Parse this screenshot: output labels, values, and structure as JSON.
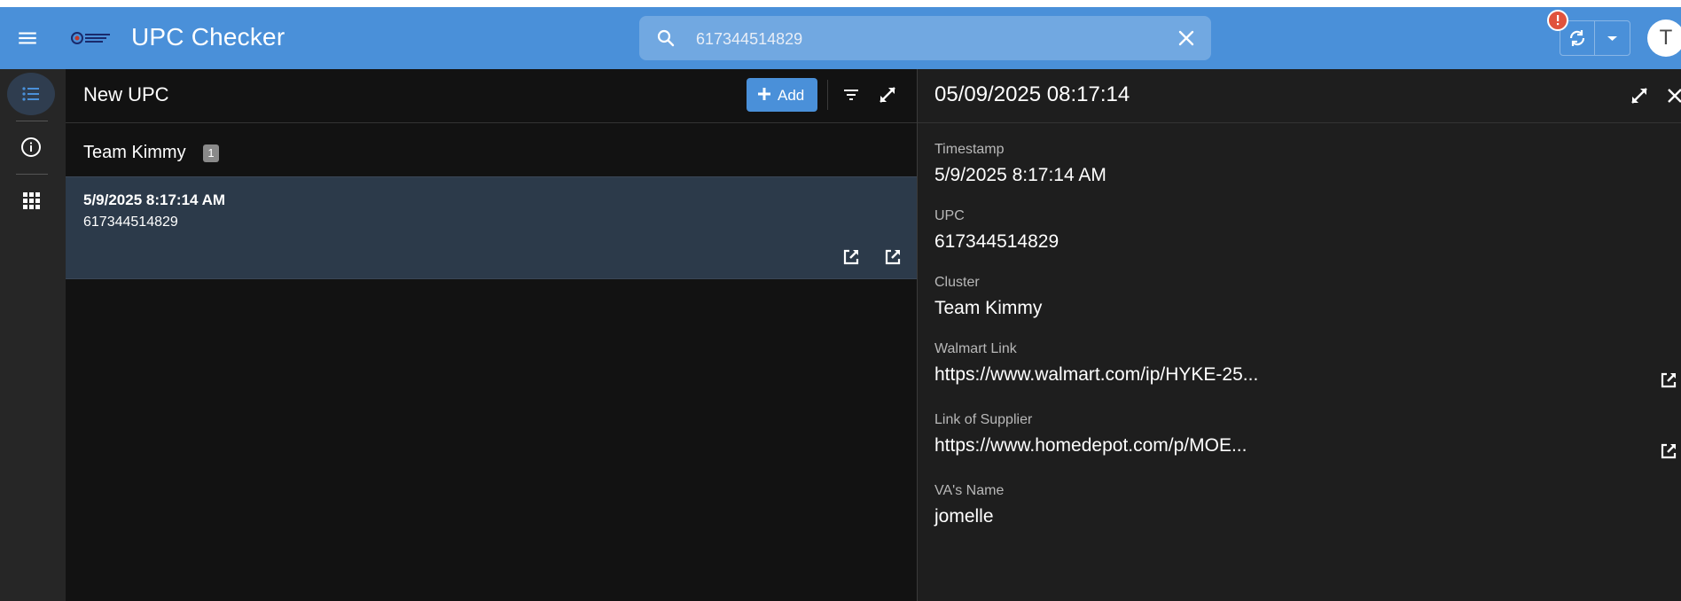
{
  "app": {
    "title": "UPC Checker",
    "avatar_initial": "T"
  },
  "search": {
    "value": "617344514829"
  },
  "list": {
    "title": "New UPC",
    "add_label": "Add",
    "group": {
      "name": "Team Kimmy",
      "count": "1"
    },
    "rows": [
      {
        "title": "5/9/2025 8:17:14 AM",
        "subtitle": "617344514829"
      }
    ]
  },
  "detail": {
    "title": "05/09/2025 08:17:14",
    "fields": [
      {
        "label": "Timestamp",
        "value": "5/9/2025 8:17:14 AM"
      },
      {
        "label": "UPC",
        "value": "617344514829"
      },
      {
        "label": "Cluster",
        "value": "Team Kimmy"
      },
      {
        "label": "Walmart Link",
        "value": "https://www.walmart.com/ip/HYKE-25..."
      },
      {
        "label": "Link of Supplier",
        "value": "https://www.homedepot.com/p/MOE..."
      },
      {
        "label": "VA's Name",
        "value": "jomelle"
      }
    ]
  },
  "colors": {
    "accent": "#4a90d9",
    "background": "#121212",
    "panel": "#1e1e1e",
    "selected_row": "#2c3a4a",
    "alert": "#e0533d"
  }
}
